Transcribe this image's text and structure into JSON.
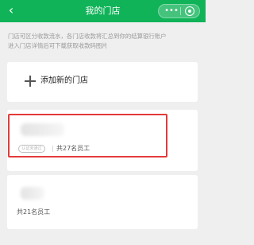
{
  "navbar": {
    "back_icon": "chevron-left-icon",
    "back_glyph": "‹",
    "title": "我的门店",
    "more_icon": "more-dots-icon",
    "more_glyph": "•••",
    "close_icon": "target-circle-icon",
    "color": "#11b359"
  },
  "notice": {
    "text": "门店可区分收款流水，各门店收款将汇总到你的结算银行账户\n进入门店详情后可下载获取收款码图片"
  },
  "add_store": {
    "icon": "plus-icon",
    "label": "添加新的门店"
  },
  "stores": [
    {
      "status_badge": "认证未通过",
      "staff_count": "共27名员工",
      "highlighted": true
    },
    {
      "staff_count": "共21名员工"
    }
  ],
  "colors": {
    "page_bg": "#efefef",
    "card_bg": "#ffffff",
    "highlight": "#e43a3a"
  }
}
